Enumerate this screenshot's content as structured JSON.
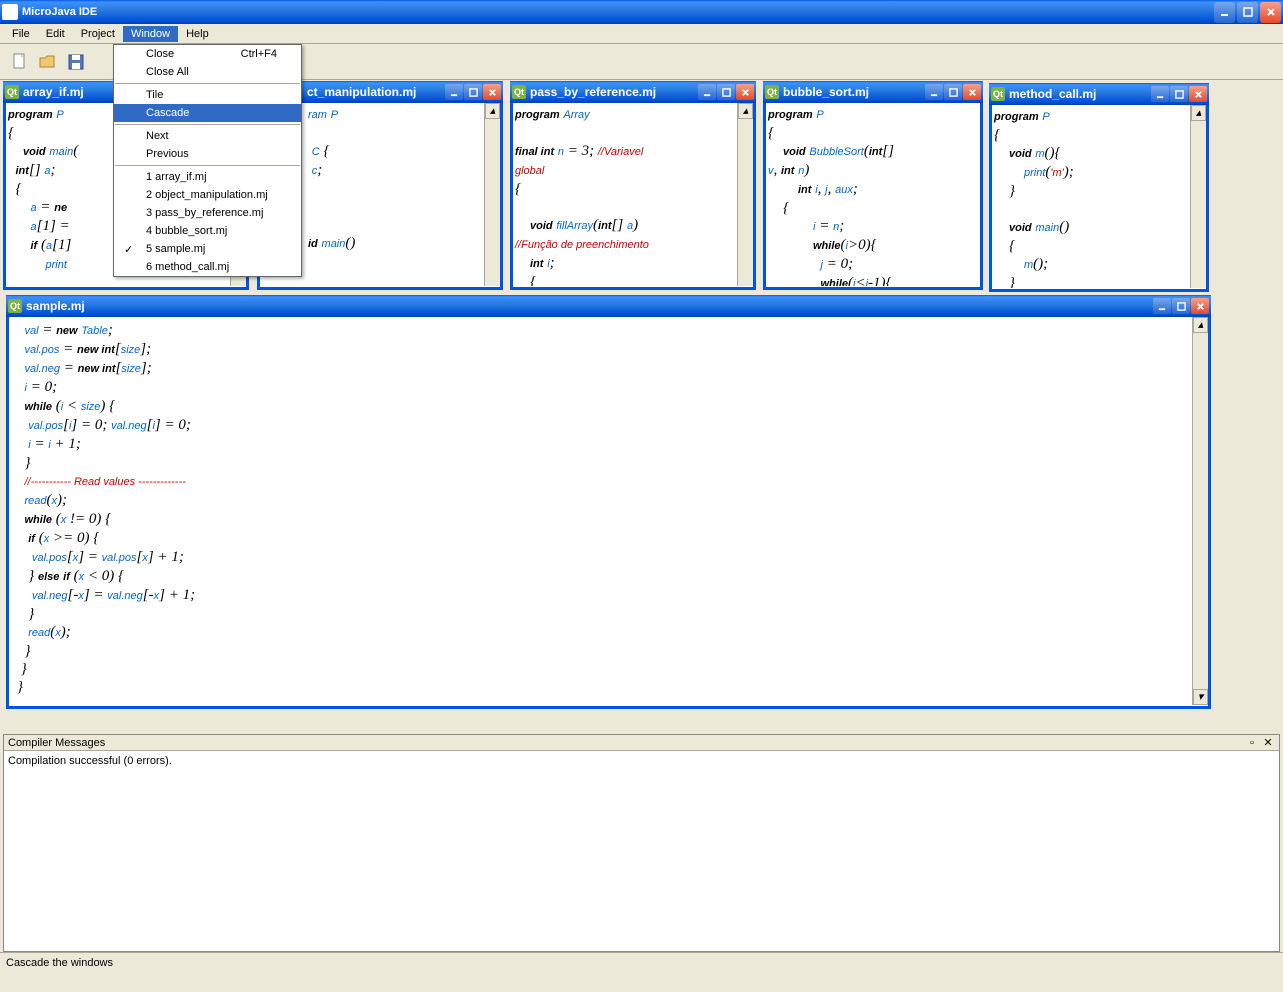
{
  "app": {
    "title": "MicroJava IDE"
  },
  "menubar": {
    "items": [
      "File",
      "Edit",
      "Project",
      "Window",
      "Help"
    ],
    "active_index": 3
  },
  "dropdown": {
    "close": "Close",
    "close_shortcut": "Ctrl+F4",
    "close_all": "Close All",
    "tile": "Tile",
    "cascade": "Cascade",
    "next": "Next",
    "previous": "Previous",
    "files": [
      "1 array_if.mj",
      "2 object_manipulation.mj",
      "3 pass_by_reference.mj",
      "4 bubble_sort.mj",
      "5 sample.mj",
      "6 method_call.mj"
    ],
    "checked_index": 4
  },
  "windows": {
    "w1": {
      "title": "array_if.mj"
    },
    "w2": {
      "title": "ct_manipulation.mj"
    },
    "w3": {
      "title": "pass_by_reference.mj"
    },
    "w4": {
      "title": "bubble_sort.mj"
    },
    "w5": {
      "title": "method_call.mj"
    },
    "w6": {
      "title": "sample.mj"
    }
  },
  "code": {
    "array_if": "program P\n{\n    void main(\n  int[] a;\n  {\n      a = new\n      a[1] = \n      if (a[1]\n          print",
    "manipulation": "ram P\n\n C {\n c;\n\n\n\nid main()",
    "pass_by_ref": "program Array\n\nfinal int n = 3; //Variavel\nglobal\n{\n\n    void fillArray(int[] a)\n//Função de preenchimento\n    int i;\n    {",
    "bubble_sort": "program P\n{\n    void BubbleSort(int[]\nv, int n)\n        int i, j, aux;\n    {\n            i = n;\n            while(i>0){\n              j = 0;\n              while(j<i-1){",
    "method_call": "program P\n{\n    void m(){\n        print('m');\n    }\n\n    void main()\n    {\n        m();\n    }",
    "sample": "  val = new Table;\n  val.pos = new int[size];\n  val.neg = new int[size];\n  i = 0;\n  while (i < size) {\n   val.pos[i] = 0; val.neg[i] = 0;\n   i = i + 1;\n  }\n  //----------- Read values -------------\n  read(x);\n  while (x != 0) {\n   if (x >= 0) {\n    val.pos[x] = val.pos[x] + 1;\n   } else if (x < 0) {\n    val.neg[-x] = val.neg[-x] + 1;\n   }\n   read(x);\n  }\n }\n}"
  },
  "compiler": {
    "header": "Compiler Messages",
    "message": "Compilation successful (0 errors)."
  },
  "statusbar": {
    "text": "Cascade the windows"
  }
}
